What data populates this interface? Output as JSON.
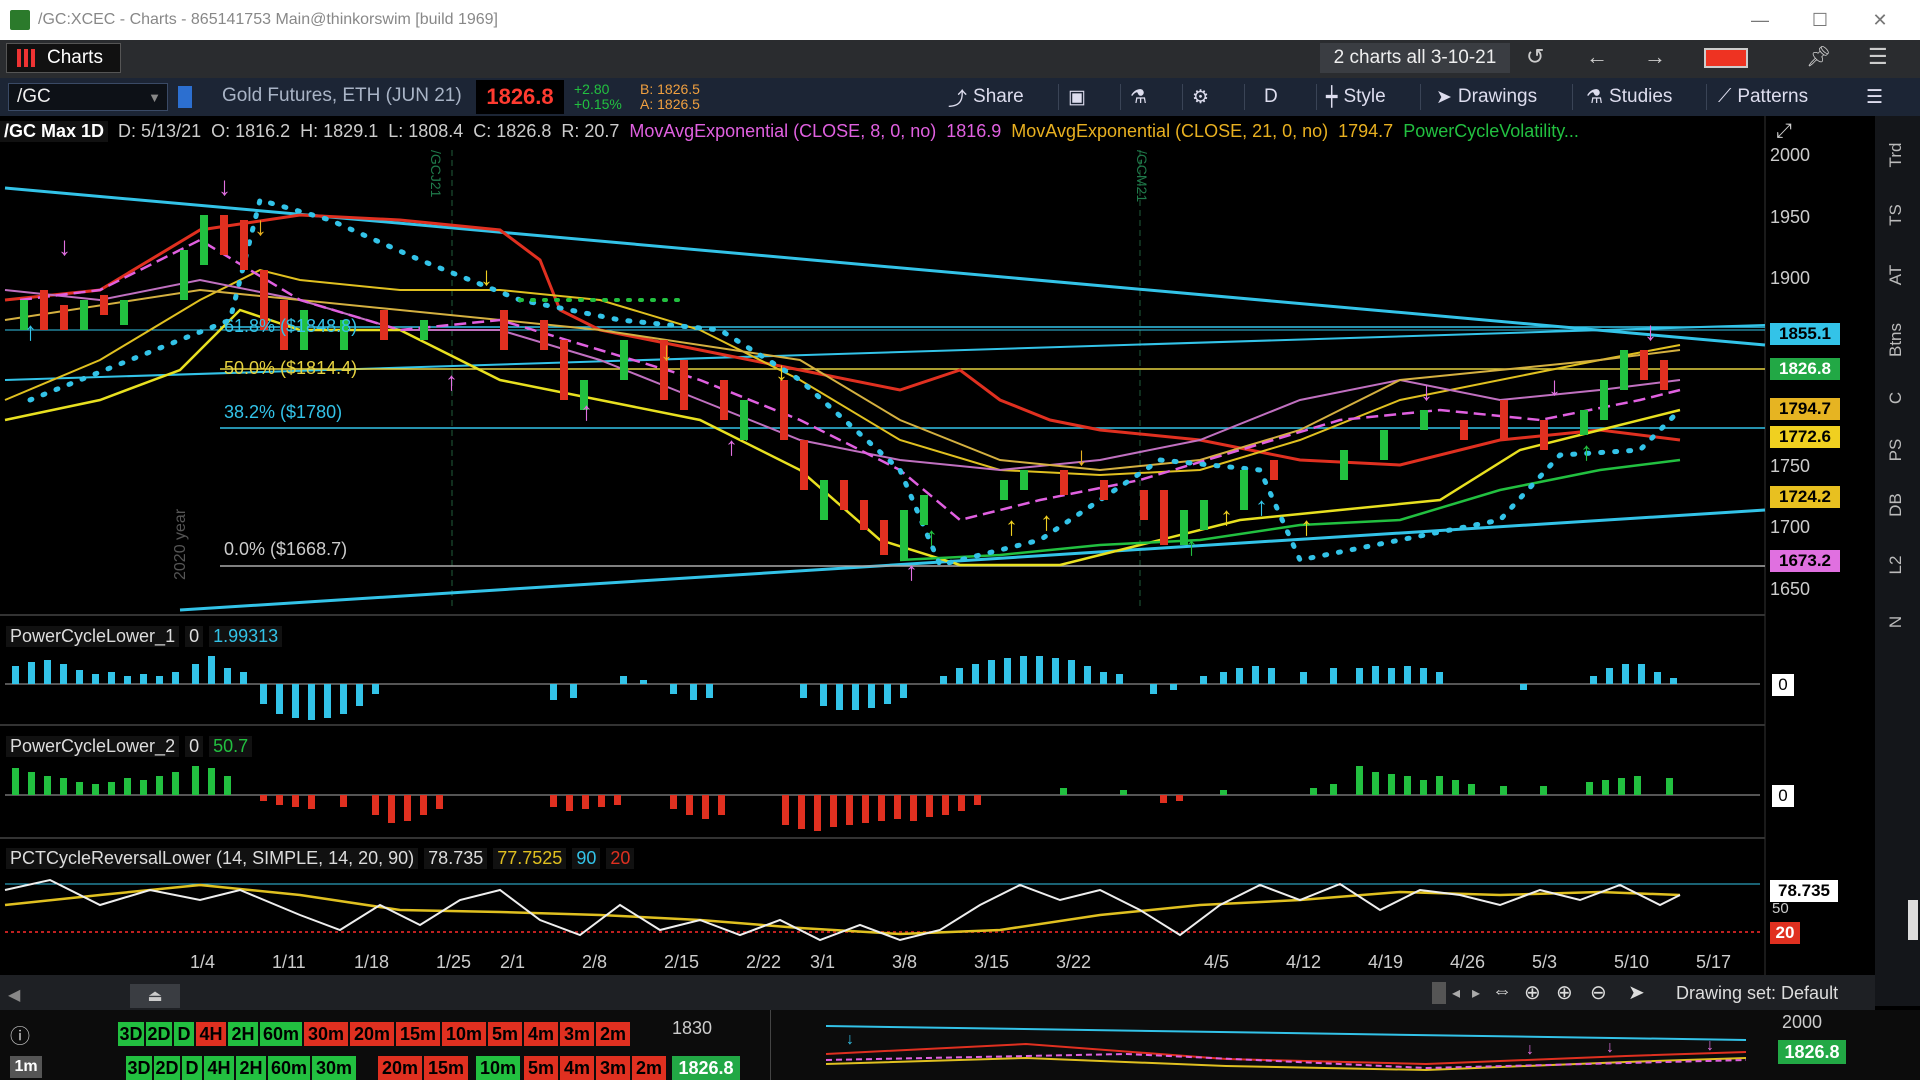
{
  "window": {
    "title": "/GC:XCEC - Charts - 865141753 Main@thinkorswim [build 1969]"
  },
  "toolbar1": {
    "charts_tab": "Charts",
    "chart_set": "2 charts all 3-10-21"
  },
  "toolbar2": {
    "symbol": "/GC",
    "description": "Gold Futures, ETH (JUN 21)",
    "last": "1826.8",
    "change": "+2.80",
    "change_pct": "+0.15%",
    "bid": "B: 1826.5",
    "ask": "A: 1826.5",
    "share": "Share",
    "aggregation": "D",
    "style": "Style",
    "drawings": "Drawings",
    "studies": "Studies",
    "patterns": "Patterns"
  },
  "studyline": {
    "name": "/GC Max 1D",
    "date": "D: 5/13/21",
    "open": "O: 1816.2",
    "high": "H: 1829.1",
    "low": "L: 1808.4",
    "close": "C: 1826.8",
    "range": "R: 20.7",
    "ema8": "MovAvgExponential (CLOSE, 8, 0, no)",
    "ema8_val": "1816.9",
    "ema21": "MovAvgExponential (CLOSE, 21, 0, no)",
    "ema21_val": "1794.7",
    "pcv": "PowerCycleVolatility..."
  },
  "fib": {
    "f618": "61.8% ($1848.8)",
    "f50": "50.0% ($1814.4)",
    "f382": "38.2% ($1780)",
    "f0": "0.0% ($1668.7)"
  },
  "contract_labels": {
    "gcj": "/GCJ21",
    "gcm": "/GCM21"
  },
  "year_label": "2020 year",
  "y_axis": [
    "2000",
    "1950",
    "1900",
    "1750",
    "1700",
    "1650"
  ],
  "price_boxes": [
    {
      "label": "1855.1",
      "color": "#33c3e8"
    },
    {
      "label": "1826.8",
      "color": "#22a845"
    },
    {
      "label": "1794.7",
      "color": "#e6b422"
    },
    {
      "label": "1772.6",
      "color": "#f0d020"
    },
    {
      "label": "1724.2",
      "color": "#e8c020"
    },
    {
      "label": "1673.2",
      "color": "#e070e0"
    }
  ],
  "x_axis": [
    "1/4",
    "1/11",
    "1/18",
    "1/25",
    "2/1",
    "2/8",
    "2/15",
    "2/22",
    "3/1",
    "3/8",
    "3/15",
    "3/22",
    "4/5",
    "4/12",
    "4/19",
    "4/26",
    "5/3",
    "5/10",
    "5/17"
  ],
  "panels": {
    "pcl1": {
      "name": "PowerCycleLower_1",
      "n": "0",
      "value": "1.99313",
      "zero": "0"
    },
    "pcl2": {
      "name": "PowerCycleLower_2",
      "n": "0",
      "value": "50.7",
      "zero": "0"
    },
    "pcr": {
      "name": "PCTCycleReversalLower (14, SIMPLE, 14, 20, 90)",
      "v1": "78.735",
      "v2": "77.7525",
      "v3": "90",
      "v4": "20",
      "axis50": "50",
      "box1": "78.735",
      "box2": "20"
    }
  },
  "bottombar": {
    "drawing_set": "Drawing set: Default"
  },
  "bottom": {
    "agg_row1": [
      "3D",
      "2D",
      "D",
      "4H",
      "2H",
      "60m",
      "30m",
      "20m",
      "15m",
      "10m",
      "5m",
      "4m",
      "3m",
      "2m"
    ],
    "agg_row2": [
      "3D",
      "2D",
      "D",
      "4H",
      "2H",
      "60m",
      "30m",
      "20m",
      "15m",
      "10m",
      "5m",
      "4m",
      "3m",
      "2m"
    ],
    "mini_label": "1m",
    "mini_price": "1830",
    "mini_box": "1826.8",
    "mini2_price": "2000",
    "mini2_box": "1826.8"
  },
  "side_tabs": [
    "Trd",
    "TS",
    "AT",
    "Btns",
    "C",
    "PS",
    "DB",
    "L2",
    "N"
  ],
  "colors": {
    "accent_red": "#e03020",
    "accent_green": "#22c040",
    "cyan": "#33c3e8"
  }
}
